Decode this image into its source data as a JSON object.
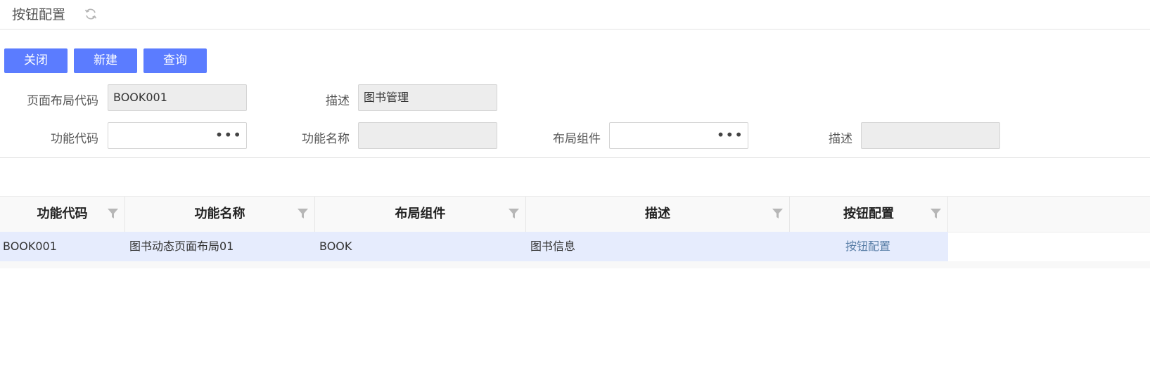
{
  "header": {
    "title": "按钮配置",
    "refresh_icon": "refresh-icon"
  },
  "toolbar": {
    "close_label": "关闭",
    "new_label": "新建",
    "query_label": "查询"
  },
  "form": {
    "layout_code_label": "页面布局代码",
    "layout_code_value": "BOOK001",
    "desc1_label": "描述",
    "desc1_value": "图书管理",
    "func_code_label": "功能代码",
    "func_code_value": "",
    "func_name_label": "功能名称",
    "func_name_value": "",
    "layout_comp_label": "布局组件",
    "layout_comp_value": "",
    "desc2_label": "描述",
    "desc2_value": "",
    "lookup_glyph": "•••"
  },
  "table": {
    "columns": [
      "功能代码",
      "功能名称",
      "布局组件",
      "描述",
      "按钮配置"
    ],
    "rows": [
      [
        "BOOK001",
        "图书动态页面布局01",
        "BOOK",
        "图书信息",
        "按钮配置"
      ]
    ]
  },
  "colors": {
    "accent": "#5b7cff",
    "row_selected": "#e6ecfd",
    "link": "#5a7fa8"
  }
}
